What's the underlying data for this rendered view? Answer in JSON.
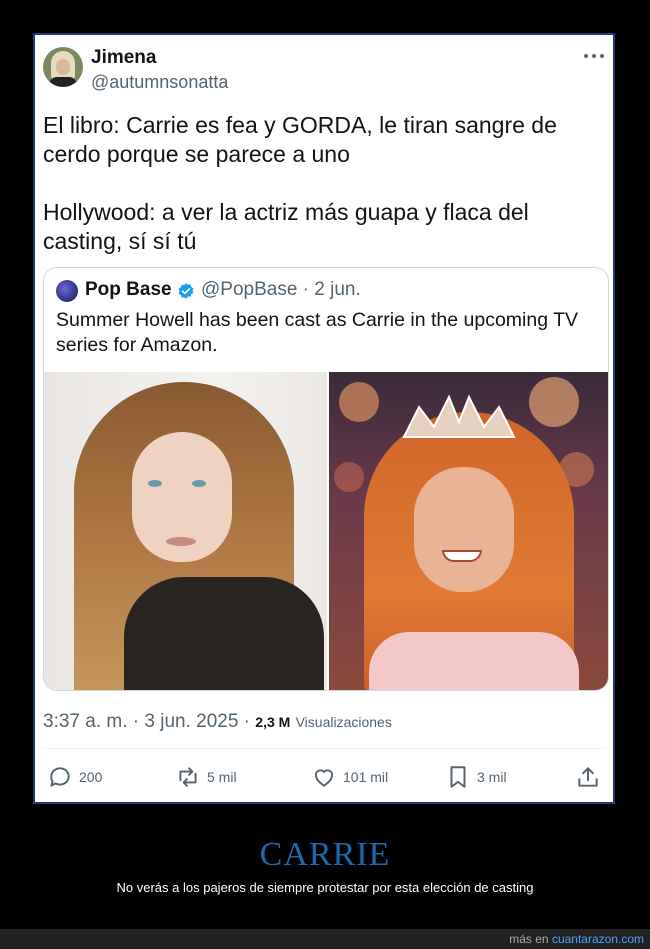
{
  "tweet": {
    "author_name": "Jimena",
    "author_handle": "@autumnsonatta",
    "text": "El libro: Carrie es fea y GORDA, le tiran sangre de cerdo porque se parece a uno\n\nHollywood: a ver la actriz más guapa y flaca del casting, sí sí tú",
    "timestamp": "3:37 a. m. · 3 jun. 2025 ·",
    "views_count": "2,3 M",
    "views_label": "Visualizaciones",
    "actions": {
      "replies": "200",
      "retweets": "5 mil",
      "likes": "101 mil",
      "bookmarks": "3 mil"
    }
  },
  "quoted": {
    "author_name": "Pop Base",
    "author_handle": "@PopBase · 2 jun.",
    "text": "Summer Howell has been cast as Carrie in the upcoming TV series for Amazon."
  },
  "caption": {
    "title": "CARRIE",
    "subtitle": "No verás a los pajeros de siempre protestar por esta elección de casting"
  },
  "footer": {
    "prefix": "más en",
    "site": "cuantarazon.com"
  },
  "colors": {
    "accent": "#1d9bf0",
    "caption_title": "#1a6ab0",
    "card_border": "#1d3a7a"
  }
}
